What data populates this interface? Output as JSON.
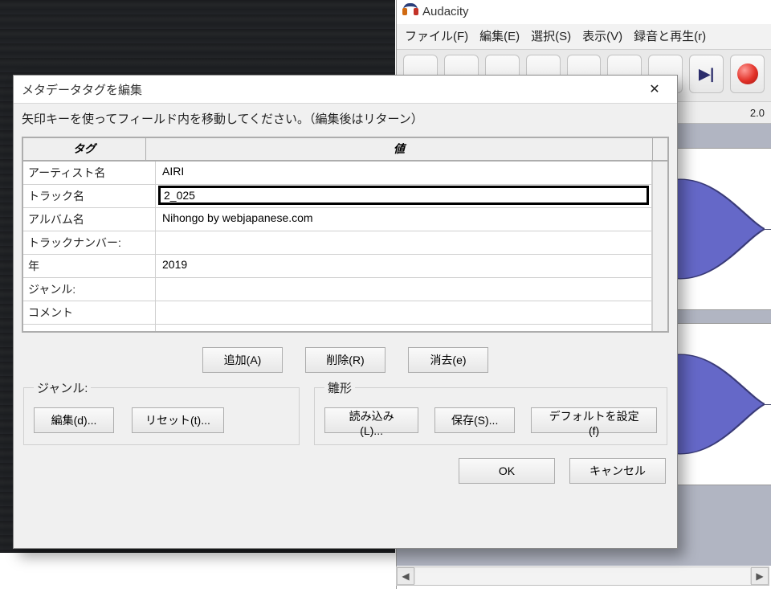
{
  "audacity": {
    "title": "Audacity",
    "menu": {
      "file": "ファイル(F)",
      "edit": "編集(E)",
      "select": "選択(S)",
      "view": "表示(V)",
      "record_play": "録音と再生(r)"
    },
    "timeline_marker": "2.0"
  },
  "dialog": {
    "title": "メタデータタグを編集",
    "instructions": "矢印キーを使ってフィールド内を移動してください。（編集後はリターン）",
    "headers": {
      "tag": "タグ",
      "value": "値"
    },
    "rows": [
      {
        "tag": "アーティスト名",
        "value": "AIRI"
      },
      {
        "tag": "トラック名",
        "value": "2_025",
        "selected": true
      },
      {
        "tag": "アルバム名",
        "value": "Nihongo by webjapanese.com"
      },
      {
        "tag": "トラックナンバー:",
        "value": ""
      },
      {
        "tag": "年",
        "value": "2019"
      },
      {
        "tag": "ジャンル:",
        "value": ""
      },
      {
        "tag": "コメント",
        "value": ""
      },
      {
        "tag": "",
        "value": ""
      }
    ],
    "buttons": {
      "add": "追加(A)",
      "remove": "削除(R)",
      "clear": "消去(e)",
      "genre_legend": "ジャンル:",
      "genre_edit": "編集(d)...",
      "genre_reset": "リセット(t)...",
      "template_legend": "雛形",
      "template_load": "読み込み(L)...",
      "template_save": "保存(S)...",
      "template_default": "デフォルトを設定(f)",
      "ok": "OK",
      "cancel": "キャンセル"
    }
  }
}
